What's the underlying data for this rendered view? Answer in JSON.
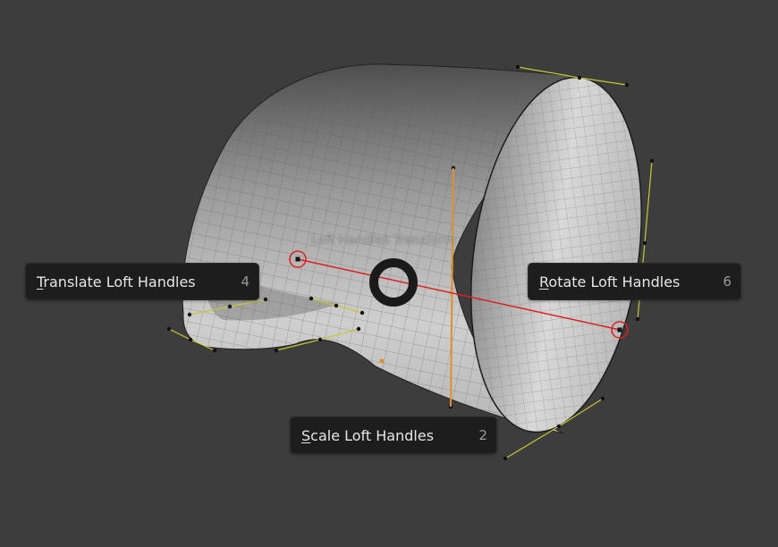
{
  "pie_menu": {
    "title": "Loft Handles Transform",
    "items": [
      {
        "hotkey_letter": "T",
        "label_rest": "ranslate Loft Handles",
        "key": "4"
      },
      {
        "hotkey_letter": "R",
        "label_rest": "otate Loft Handles",
        "key": "6"
      },
      {
        "hotkey_letter": "S",
        "label_rest": "cale Loft Handles",
        "key": "2"
      }
    ]
  },
  "colors": {
    "background": "#3d3d3d",
    "menu_item_bg": "#1d1d1d",
    "menu_text": "#e6e6e6",
    "hotkey_text": "#9a9a9a",
    "handle_line": "#c8c832",
    "active_axis": "#e0902a",
    "transform_line": "#dd1f1f"
  },
  "icons": {
    "pie_center": "pie-center-ring-icon",
    "handle_marker": "circle-handle-icon"
  }
}
